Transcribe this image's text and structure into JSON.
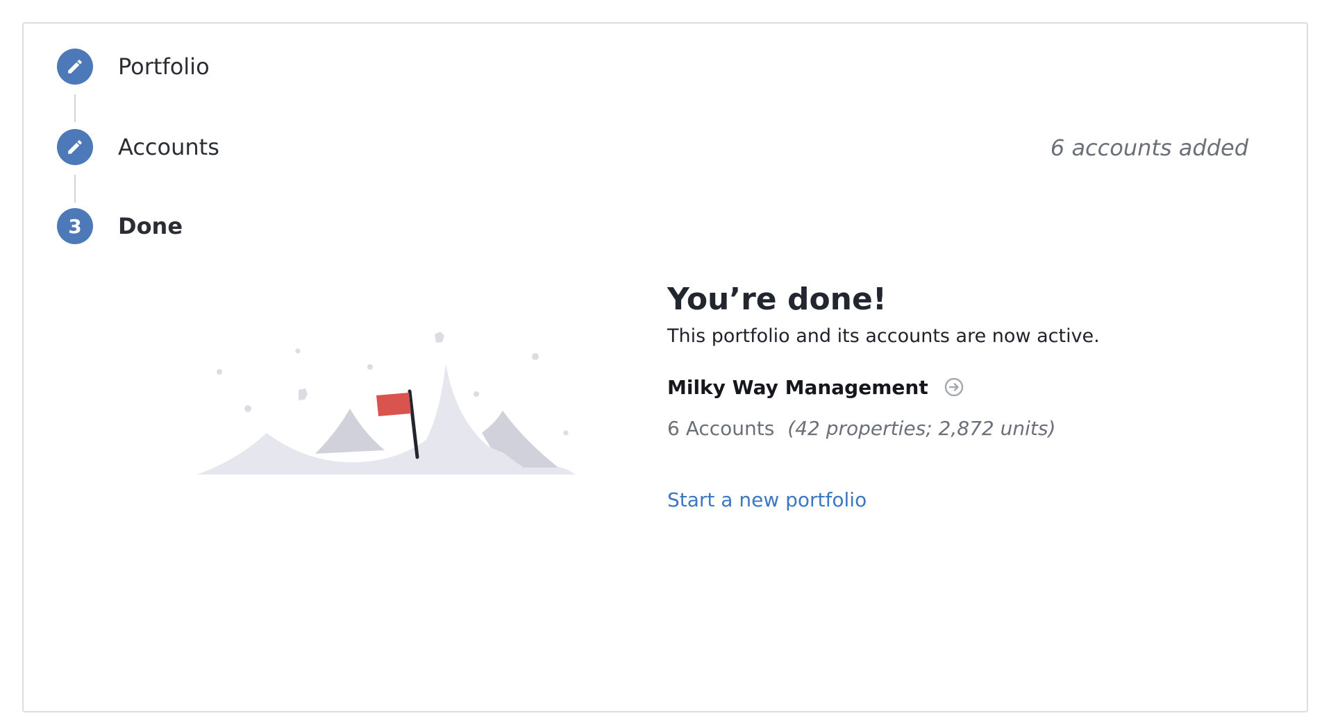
{
  "steps": [
    {
      "label": "Portfolio",
      "icon": "pencil-icon",
      "state": "completed"
    },
    {
      "label": "Accounts",
      "icon": "pencil-icon",
      "state": "completed"
    },
    {
      "label": "Done",
      "number": "3",
      "state": "current"
    }
  ],
  "accounts_summary": "6 accounts added",
  "done": {
    "title": "You’re done!",
    "subtitle": "This portfolio and its accounts are now active.",
    "portfolio_name": "Milky Way Management",
    "accounts_count": "6 Accounts",
    "accounts_detail": "(42 properties; 2,872 units)",
    "new_portfolio_link": "Start a new portfolio"
  },
  "colors": {
    "accent": "#4d79b9",
    "link": "#3a78c3",
    "flag": "#d9534f",
    "mountain": "#e6e6ee",
    "mountain_shadow": "#d1d1db"
  }
}
